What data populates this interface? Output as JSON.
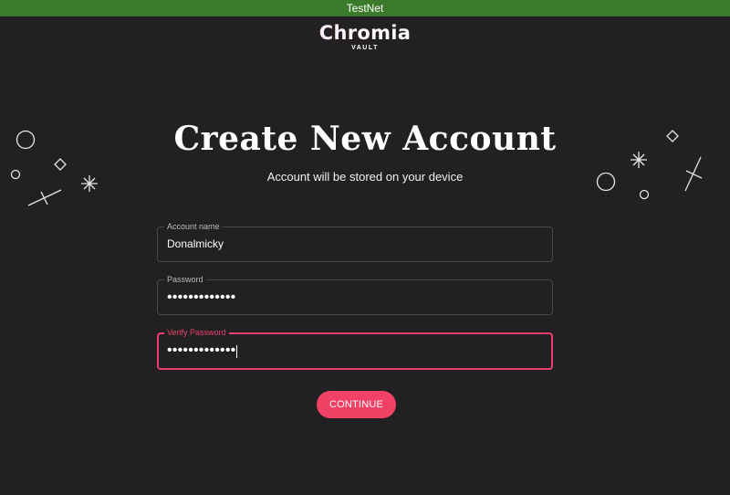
{
  "banner": {
    "network_label": "TestNet"
  },
  "brand": {
    "name": "Chromia",
    "subtitle": "VAULT"
  },
  "page": {
    "title": "Create New Account",
    "subtitle": "Account will be stored on your device"
  },
  "form": {
    "account_name": {
      "label": "Account name",
      "value": "Donalmicky"
    },
    "password": {
      "label": "Password",
      "value": "•••••••••••••"
    },
    "verify_password": {
      "label": "Verify Password",
      "value": "•••••••••••••"
    },
    "continue_label": "CONTINUE"
  },
  "colors": {
    "banner_bg": "#3b7a2a",
    "background": "#232023",
    "accent": "#f14165",
    "error": "#e8426a"
  }
}
